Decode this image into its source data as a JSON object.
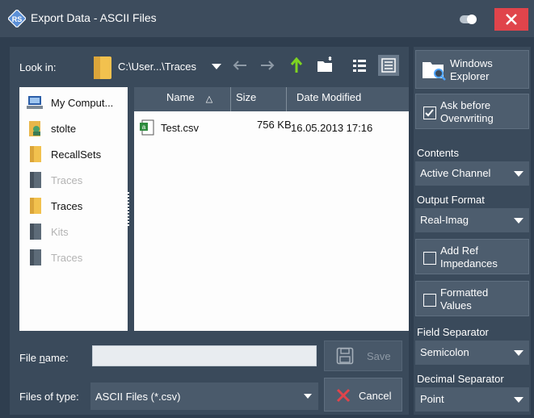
{
  "window": {
    "title": "Export Data - ASCII Files",
    "close_icon": "close-icon",
    "toggle_icon": "toggle-icon",
    "colors": {
      "titlebar": "#3d4c5d",
      "close": "#e0444b",
      "background": "#2f3e4f"
    }
  },
  "lookin": {
    "label": "Look in:",
    "path": "C:\\User...\\Traces",
    "icons": [
      "back-arrow-icon",
      "forward-arrow-icon",
      "up-arrow-icon",
      "new-folder-icon",
      "list-view-icon",
      "detail-view-icon"
    ]
  },
  "sidebar": {
    "items": [
      {
        "label": "My Comput...",
        "icon": "computer-icon",
        "enabled": true
      },
      {
        "label": "stolte",
        "icon": "user-folder-icon",
        "enabled": true
      },
      {
        "label": "RecallSets",
        "icon": "folder-icon",
        "enabled": true
      },
      {
        "label": "Traces",
        "icon": "folder-icon",
        "enabled": false
      },
      {
        "label": "Traces",
        "icon": "folder-icon",
        "enabled": true
      },
      {
        "label": "Kits",
        "icon": "folder-icon",
        "enabled": false
      },
      {
        "label": "Traces",
        "icon": "folder-icon",
        "enabled": false
      }
    ]
  },
  "files": {
    "columns": [
      "Name",
      "Size",
      "Date Modified"
    ],
    "sort_indicator": "△",
    "rows": [
      {
        "name": "Test.csv",
        "size": "756 KB",
        "date": "16.05.2013 17:16",
        "icon": "csv-file-icon"
      }
    ]
  },
  "filename": {
    "label": "File name:",
    "value": "",
    "save_label": "Save",
    "save_icon": "floppy-disk-icon"
  },
  "filetype": {
    "label": "Files of type:",
    "selected": "ASCII Files (*.csv)",
    "cancel_label": "Cancel",
    "cancel_icon": "x-icon"
  },
  "right": {
    "explorer_label_1": "Windows",
    "explorer_label_2": "Explorer",
    "ask_label_1": "Ask before",
    "ask_label_2": "Overwriting",
    "ask_checked": true,
    "contents_label": "Contents",
    "contents_value": "Active Channel",
    "output_label": "Output Format",
    "output_value": "Real-Imag",
    "addref_label_1": "Add Ref",
    "addref_label_2": "Impedances",
    "addref_checked": false,
    "formatted_label_1": "Formatted",
    "formatted_label_2": "Values",
    "formatted_checked": false,
    "field_sep_label": "Field Separator",
    "field_sep_value": "Semicolon",
    "decimal_sep_label": "Decimal Separator",
    "decimal_sep_value": "Point"
  }
}
